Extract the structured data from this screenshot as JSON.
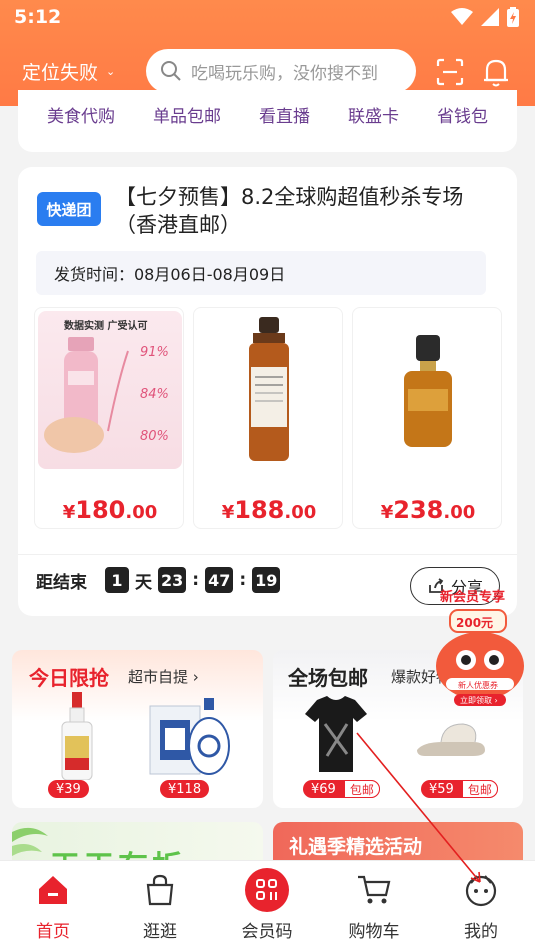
{
  "status_bar": {
    "time": "5:12"
  },
  "header": {
    "location": "定位失败",
    "search_placeholder": "吃喝玩乐购，没你搜不到"
  },
  "categories": [
    "美食代购",
    "单品包邮",
    "看直播",
    "联盛卡",
    "省钱包"
  ],
  "flash_card": {
    "badge": "快递团",
    "title": "【七夕预售】8.2全球购超值秒杀专场（香港直邮）",
    "ship_label": "发货时间：08月06日-08月09日",
    "products": [
      {
        "yen": "¥",
        "int": "180",
        "dec": ".00",
        "image_caption": "数据实测 广受认可",
        "stats": [
          "91%",
          "84%",
          "80%"
        ]
      },
      {
        "yen": "¥",
        "int": "188",
        "dec": ".00"
      },
      {
        "yen": "¥",
        "int": "238",
        "dec": ".00"
      }
    ],
    "countdown": {
      "label": "距结束",
      "days": "1",
      "day_unit": "天",
      "hours": "23",
      "minutes": "47",
      "seconds": "19"
    },
    "share_label": "分享"
  },
  "promo_left": {
    "title": "今日限抢",
    "subtitle": "超市自提 ›",
    "items": [
      {
        "price": "¥39"
      },
      {
        "price": "¥118"
      }
    ]
  },
  "promo_right": {
    "title": "全场包邮",
    "subtitle": "爆款好物",
    "items": [
      {
        "price": "¥69",
        "badge": "包邮"
      },
      {
        "price": "¥59",
        "badge": "包邮"
      }
    ]
  },
  "banner_left_text": "天天有折",
  "banner_right_text": "礼遇季精选活动",
  "floating_promo": {
    "title": "新会员专享",
    "amount": "200元",
    "cta": "立即领取 ›",
    "sub": "新人优惠券"
  },
  "tabbar": [
    {
      "label": "首页",
      "icon": "home-icon",
      "active": true
    },
    {
      "label": "逛逛",
      "icon": "bag-icon",
      "active": false
    },
    {
      "label": "会员码",
      "icon": "member-code-icon",
      "active": false
    },
    {
      "label": "购物车",
      "icon": "cart-icon",
      "active": false
    },
    {
      "label": "我的",
      "icon": "profile-icon",
      "active": false
    }
  ],
  "colors": {
    "header": "#ff7a45",
    "accent_red": "#e8232d",
    "badge_blue": "#2a7df0",
    "category_purple": "#6a3d8f"
  }
}
